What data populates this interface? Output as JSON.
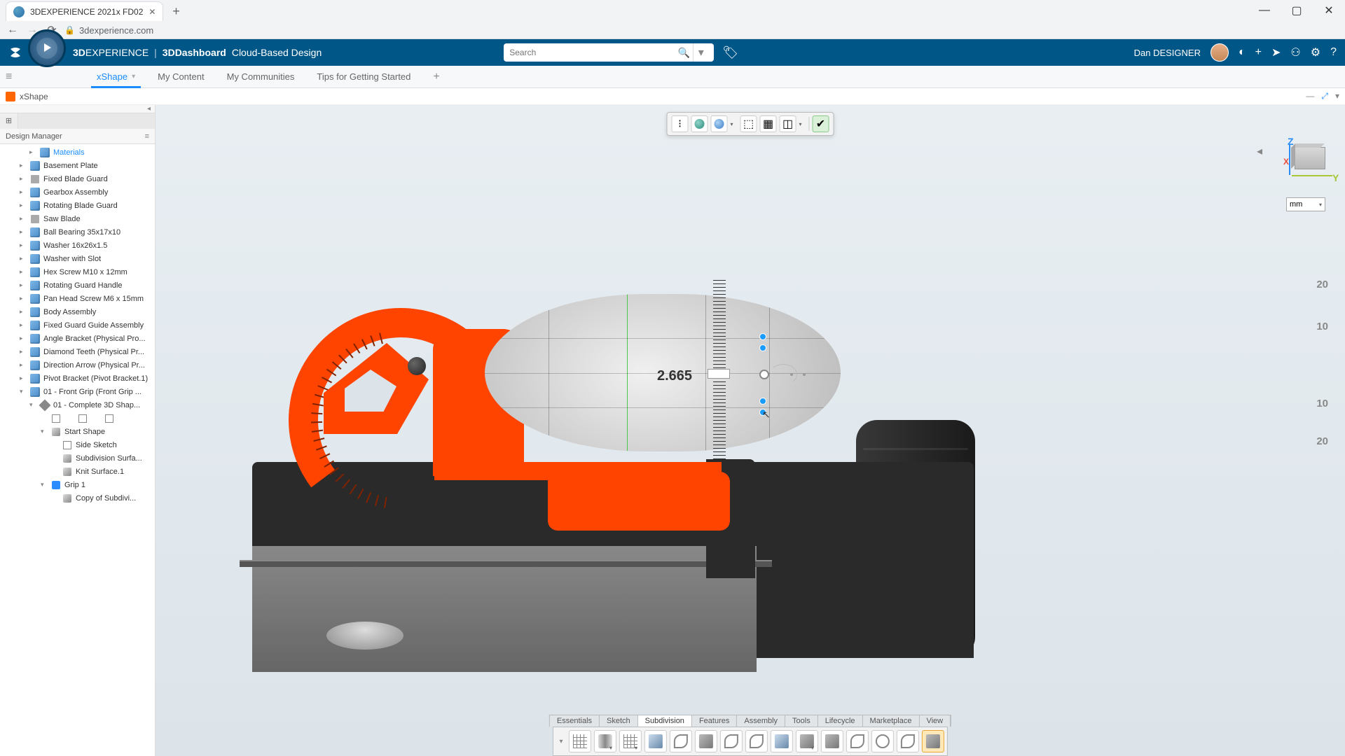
{
  "browser": {
    "tab_title": "3DEXPERIENCE 2021x FD02",
    "url": "3dexperience.com"
  },
  "header": {
    "brand_bold": "3D",
    "brand_rest": "EXPERIENCE",
    "dashboard_bold": "3DDashboard",
    "subtitle": "Cloud-Based Design",
    "search_placeholder": "Search",
    "user_name": "Dan DESIGNER"
  },
  "tabs": {
    "items": [
      "xShape",
      "My Content",
      "My Communities",
      "Tips for Getting Started"
    ],
    "active_index": 0
  },
  "widget": {
    "title": "xShape"
  },
  "sidebar": {
    "title": "Design Manager",
    "tree": [
      {
        "label": "Materials",
        "type": "materials",
        "indent": 2,
        "arrow": "▸"
      },
      {
        "label": "Basement Plate",
        "type": "part",
        "indent": 1,
        "arrow": "▸"
      },
      {
        "label": "Fixed Blade Guard",
        "type": "sketch",
        "indent": 1,
        "arrow": "▸"
      },
      {
        "label": "Gearbox Assembly",
        "type": "part",
        "indent": 1,
        "arrow": "▸"
      },
      {
        "label": "Rotating Blade Guard",
        "type": "part",
        "indent": 1,
        "arrow": "▸"
      },
      {
        "label": "Saw Blade",
        "type": "sketch",
        "indent": 1,
        "arrow": "▸"
      },
      {
        "label": "Ball Bearing 35x17x10",
        "type": "part",
        "indent": 1,
        "arrow": "▸"
      },
      {
        "label": "Washer 16x26x1.5",
        "type": "part",
        "indent": 1,
        "arrow": "▸"
      },
      {
        "label": "Washer with Slot",
        "type": "part",
        "indent": 1,
        "arrow": "▸"
      },
      {
        "label": "Hex Screw M10 x 12mm",
        "type": "part",
        "indent": 1,
        "arrow": "▸"
      },
      {
        "label": "Rotating Guard Handle",
        "type": "part",
        "indent": 1,
        "arrow": "▸"
      },
      {
        "label": "Pan Head Screw M6 x 15mm",
        "type": "part",
        "indent": 1,
        "arrow": "▸"
      },
      {
        "label": "Body Assembly",
        "type": "part",
        "indent": 1,
        "arrow": "▸"
      },
      {
        "label": "Fixed Guard Guide Assembly",
        "type": "part",
        "indent": 1,
        "arrow": "▸"
      },
      {
        "label": "Angle Bracket (Physical Pro...",
        "type": "part",
        "indent": 1,
        "arrow": "▸"
      },
      {
        "label": "Diamond Teeth (Physical Pr...",
        "type": "part",
        "indent": 1,
        "arrow": "▸"
      },
      {
        "label": "Direction Arrow (Physical Pr...",
        "type": "part",
        "indent": 1,
        "arrow": "▸"
      },
      {
        "label": "Pivot Bracket (Pivot Bracket.1)",
        "type": "part",
        "indent": 1,
        "arrow": "▸"
      },
      {
        "label": "01 - Front Grip (Front Grip ...",
        "type": "part",
        "indent": 1,
        "arrow": "▾"
      },
      {
        "label": "01 - Complete 3D Shap...",
        "type": "shape",
        "indent": 2,
        "arrow": "▾"
      },
      {
        "label": "",
        "type": "icons-row",
        "indent": 3,
        "arrow": ""
      },
      {
        "label": "Start Shape",
        "type": "surf",
        "indent": 3,
        "arrow": "▾"
      },
      {
        "label": "Side Sketch",
        "type": "sketch2",
        "indent": 4,
        "arrow": ""
      },
      {
        "label": "Subdivision Surfa...",
        "type": "surf",
        "indent": 4,
        "arrow": ""
      },
      {
        "label": "Knit Surface.1",
        "type": "surf",
        "indent": 4,
        "arrow": ""
      },
      {
        "label": "Grip 1",
        "type": "grip",
        "indent": 3,
        "arrow": "▾"
      },
      {
        "label": "Copy of Subdivi...",
        "type": "surf",
        "indent": 4,
        "arrow": ""
      }
    ]
  },
  "viewport": {
    "units": "mm",
    "axes": {
      "z": "Z",
      "x": "X",
      "y": "Y"
    },
    "measurement": {
      "value": "2.665"
    },
    "ruler_labels": [
      "20",
      "10",
      "10",
      "20"
    ]
  },
  "bottom_tabs": [
    "Essentials",
    "Sketch",
    "Subdivision",
    "Features",
    "Assembly",
    "Tools",
    "Lifecycle",
    "Marketplace",
    "View"
  ],
  "bottom_active_index": 2,
  "bottom_tools": [
    "grid-tool",
    "primitive-cylinder",
    "plane-tool",
    "fill-tool",
    "sweep-tool",
    "extrude-tool",
    "bend-tool",
    "loft-tool",
    "shell-tool",
    "box-tool",
    "subtract-tool",
    "knife-tool",
    "sphere-tool",
    "bridge-tool",
    "subd-cage-tool"
  ]
}
